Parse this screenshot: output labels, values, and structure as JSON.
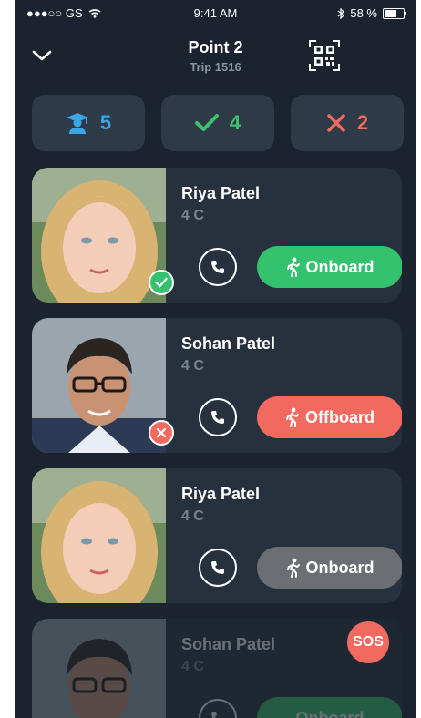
{
  "status_bar": {
    "carrier": "●●●○○ GS",
    "time": "9:41 AM",
    "battery": "58 %"
  },
  "header": {
    "title": "Point 2",
    "subtitle": "Trip 1516"
  },
  "stats": [
    {
      "icon": "student-icon",
      "value": "5",
      "color": "#39a6e6"
    },
    {
      "icon": "check-icon",
      "value": "4",
      "color": "#3ec16f"
    },
    {
      "icon": "cross-icon",
      "value": "2",
      "color": "#f26a5f"
    }
  ],
  "students": [
    {
      "name": "Riya Patel",
      "class": "4 C",
      "action": "Onboard",
      "action_color": "#34c26e",
      "status": "check"
    },
    {
      "name": "Sohan Patel",
      "class": "4 C",
      "action": "Offboard",
      "action_color": "#f26a5f",
      "status": "cross"
    },
    {
      "name": "Riya Patel",
      "class": "4 C",
      "action": "Onboard",
      "action_color": "#6b6f73",
      "status": "none"
    },
    {
      "name": "Sohan Patel",
      "class": "4 C",
      "action": "Onboard",
      "action_color": "#34c26e",
      "status": "none"
    }
  ],
  "sos": {
    "label": "SOS",
    "color": "#f26a5f"
  }
}
